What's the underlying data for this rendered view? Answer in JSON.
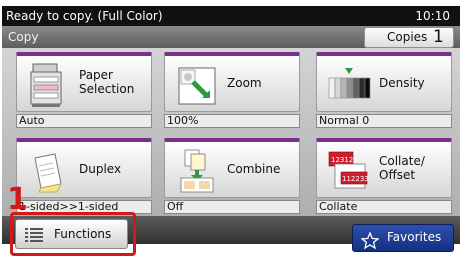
{
  "status_bar": {
    "message": "Ready to copy. (Full Color)",
    "time": "10:10"
  },
  "title_bar": {
    "title": "Copy",
    "copies_label": "Copies",
    "copies_value": "1"
  },
  "tiles": [
    {
      "label": "Paper Selection",
      "status": "Auto",
      "icon": "paper-selection-icon"
    },
    {
      "label": "Zoom",
      "status": "100%",
      "icon": "zoom-icon"
    },
    {
      "label": "Density",
      "status": "Normal 0",
      "icon": "density-icon"
    },
    {
      "label": "Duplex",
      "status": "1-sided>>1-sided",
      "icon": "duplex-icon"
    },
    {
      "label": "Combine",
      "status": "Off",
      "icon": "combine-icon"
    },
    {
      "label": "Collate/ Offset",
      "status": "Collate",
      "icon": "collate-offset-icon"
    }
  ],
  "bottom_bar": {
    "functions_label": "Functions",
    "favorites_label": "Favorites"
  },
  "annotation": {
    "step_number": "1"
  },
  "colors": {
    "accent": "#7a2f8c",
    "highlight": "#d2191a",
    "favorites": "#1f3f9a"
  }
}
